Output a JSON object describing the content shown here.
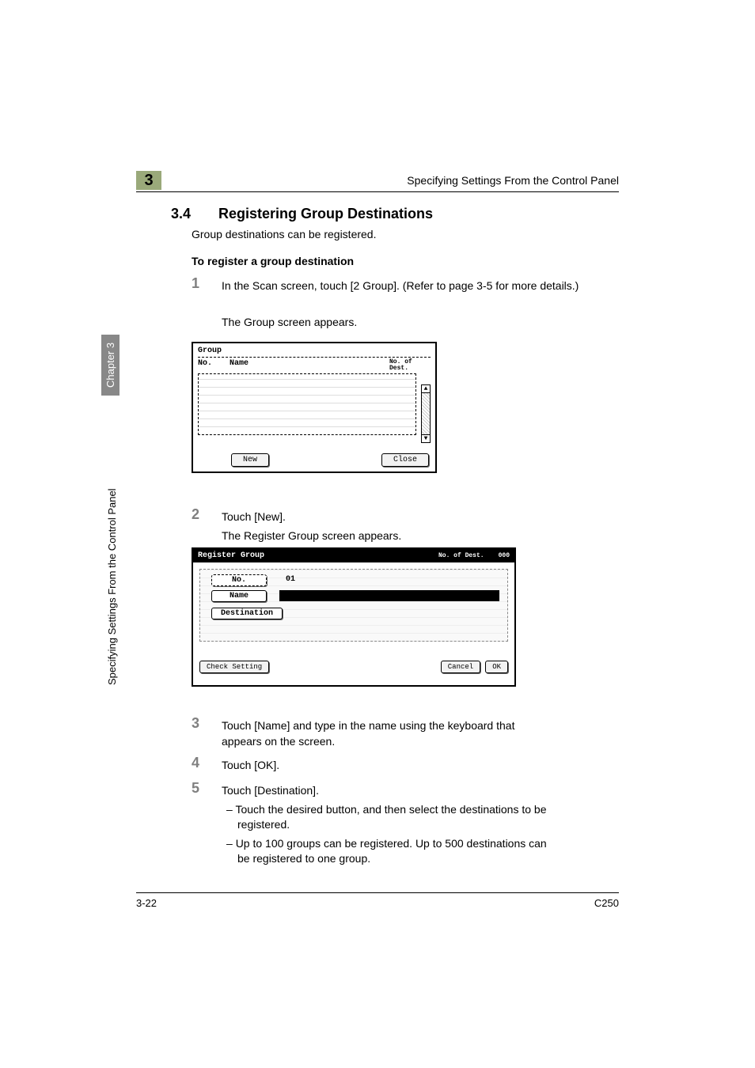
{
  "header": {
    "chapter_marker": "3",
    "running_title": "Specifying Settings From the Control Panel"
  },
  "sidebar": {
    "chapter": "Chapter 3",
    "title": "Specifying Settings From the Control Panel"
  },
  "section": {
    "number": "3.4",
    "title": "Registering Group Destinations",
    "intro": "Group destinations can be registered.",
    "subsection": "To register a group destination"
  },
  "steps": {
    "s1": {
      "num": "1",
      "text": "In the Scan screen, touch [2 Group]. (Refer to page 3-5 for more details.)",
      "after": "The Group screen appears."
    },
    "s2": {
      "num": "2",
      "text": "Touch [New].",
      "after": "The Register Group screen appears."
    },
    "s3": {
      "num": "3",
      "text": "Touch [Name] and type in the name using the keyboard that appears on the screen."
    },
    "s4": {
      "num": "4",
      "text": "Touch [OK]."
    },
    "s5": {
      "num": "5",
      "text": "Touch [Destination].",
      "bullets": [
        "Touch the desired button, and then select the destinations to be registered.",
        "Up to 100 groups can be registered. Up to 500 destinations can be registered to one group."
      ]
    }
  },
  "screen1": {
    "title": "Group",
    "col_no": "No.",
    "col_name": "Name",
    "col_dest": "No. of Dest.",
    "btn_new": "New",
    "btn_close": "Close"
  },
  "screen2": {
    "title": "Register Group",
    "dest_count_label": "No. of Dest.",
    "dest_count_value": "000",
    "field_no": "No.",
    "field_no_value": "01",
    "field_name": "Name",
    "field_dest": "Destination",
    "btn_check": "Check Setting",
    "btn_cancel": "Cancel",
    "btn_ok": "OK"
  },
  "footer": {
    "page": "3-22",
    "model": "C250"
  }
}
